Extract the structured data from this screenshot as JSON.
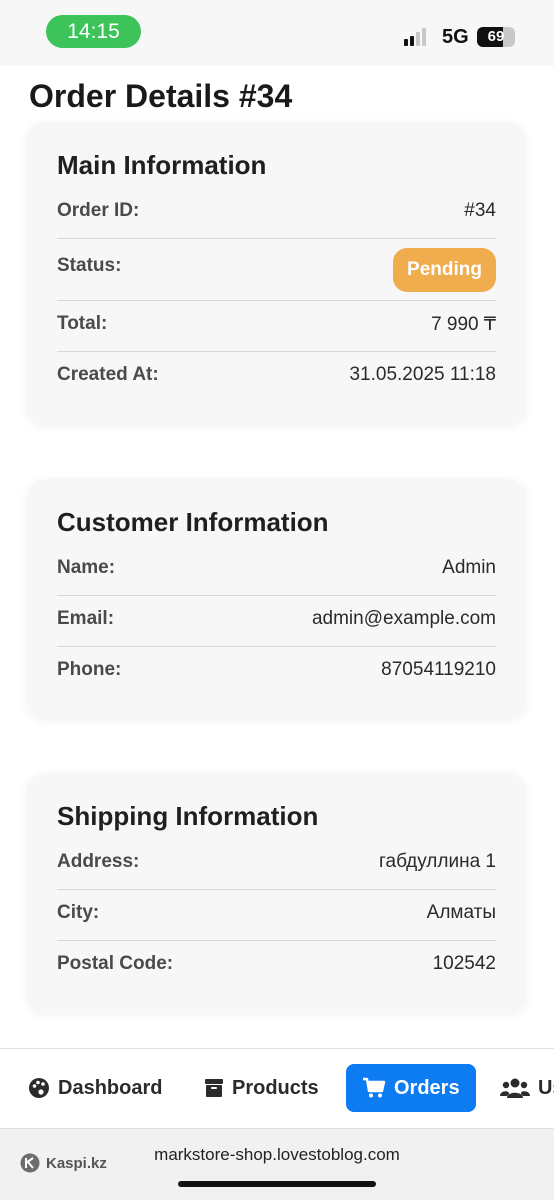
{
  "status_bar": {
    "time": "14:15",
    "network": "5G",
    "battery": "69",
    "battery_level": 0.69
  },
  "page": {
    "title": "Order Details #34"
  },
  "main_info": {
    "title": "Main Information",
    "rows": [
      {
        "label": "Order ID:",
        "value": "#34"
      },
      {
        "label": "Status:",
        "value": "Pending"
      },
      {
        "label": "Total:",
        "value": "7 990 ₸"
      },
      {
        "label": "Created At:",
        "value": "31.05.2025 11:18"
      }
    ],
    "status_color": "#f0ad4e"
  },
  "customer_info": {
    "title": "Customer Information",
    "rows": [
      {
        "label": "Name:",
        "value": "Admin"
      },
      {
        "label": "Email:",
        "value": "admin@example.com"
      },
      {
        "label": "Phone:",
        "value": "87054119210"
      }
    ]
  },
  "shipping_info": {
    "title": "Shipping Information",
    "rows": [
      {
        "label": "Address:",
        "value": "габдуллина 1"
      },
      {
        "label": "City:",
        "value": "Алматы"
      },
      {
        "label": "Postal Code:",
        "value": "102542"
      }
    ]
  },
  "bottom_nav": {
    "items": [
      {
        "label": "Dashboard",
        "icon": "palette-icon"
      },
      {
        "label": "Products",
        "icon": "box-icon"
      },
      {
        "label": "Orders",
        "icon": "cart-icon",
        "active": true
      },
      {
        "label": "Us",
        "icon": "users-icon"
      }
    ],
    "accent": "#0d7bf2"
  },
  "browser": {
    "brand": "Kaspi.kz",
    "url": "markstore-shop.lovestoblog.com"
  }
}
